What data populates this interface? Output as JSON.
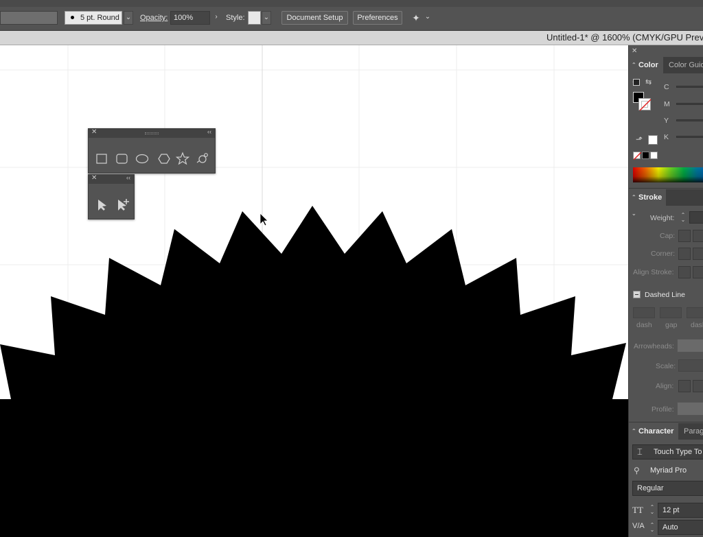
{
  "control_bar": {
    "brush_label": "5 pt. Round",
    "opacity_label": "Opacity:",
    "opacity_value": "100%",
    "style_label": "Style:",
    "document_setup_label": "Document Setup",
    "preferences_label": "Preferences",
    "arrange_icon": "arrange-documents-icon"
  },
  "document": {
    "title": "Untitled-1* @ 1600% (CMYK/GPU Prev"
  },
  "canvas": {
    "shape_color": "#000000",
    "background_color": "#ffffff",
    "grid_color": "#e9e9e9"
  },
  "shapes_panel": {
    "tools": [
      "rectangle-icon",
      "rounded-rectangle-icon",
      "ellipse-icon",
      "polygon-icon",
      "star-icon",
      "flare-icon"
    ]
  },
  "selection_panel": {
    "tools": [
      "selection-arrow-icon",
      "add-anchor-icon"
    ]
  },
  "right_panel": {
    "color_tabs": [
      "Color",
      "Color Guid"
    ],
    "cmyk_labels": [
      "C",
      "M",
      "Y",
      "K"
    ],
    "stroke_tab": "Stroke",
    "weight_label": "Weight:",
    "cap_label": "Cap:",
    "corner_label": "Corner:",
    "align_stroke_label": "Align Stroke:",
    "dashed_line_label": "Dashed Line",
    "dash_labels": [
      "dash",
      "gap",
      "dash"
    ],
    "arrowheads_label": "Arrowheads:",
    "scale_label": "Scale:",
    "align_label": "Align:",
    "profile_label": "Profile:",
    "character_tabs": [
      "Character",
      "Parag"
    ],
    "touch_type_label": "Touch Type To",
    "font_family": "Myriad Pro",
    "font_style": "Regular",
    "font_size": "12 pt",
    "kerning": "Auto"
  }
}
